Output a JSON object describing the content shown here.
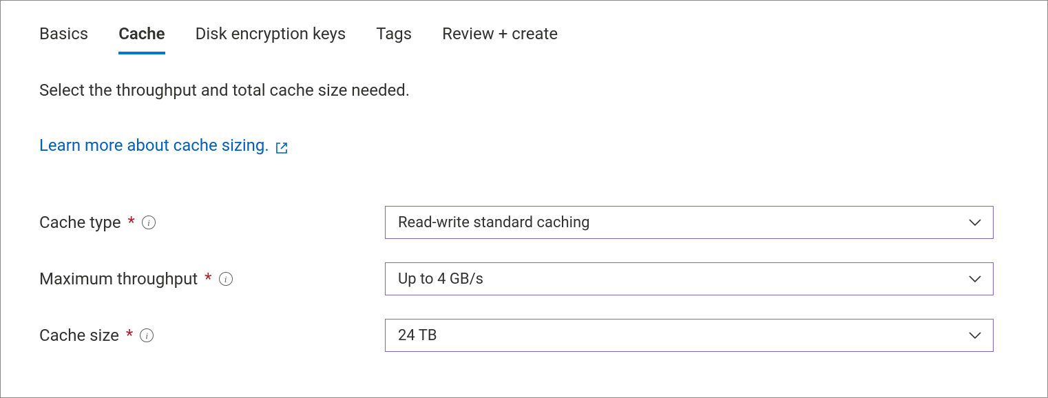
{
  "tabs": [
    {
      "label": "Basics",
      "active": false
    },
    {
      "label": "Cache",
      "active": true
    },
    {
      "label": "Disk encryption keys",
      "active": false
    },
    {
      "label": "Tags",
      "active": false
    },
    {
      "label": "Review + create",
      "active": false
    }
  ],
  "description": "Select the throughput and total cache size needed.",
  "learn_link": {
    "text": "Learn more about cache sizing."
  },
  "fields": {
    "cache_type": {
      "label": "Cache type",
      "required": true,
      "value": "Read-write standard caching"
    },
    "max_throughput": {
      "label": "Maximum throughput",
      "required": true,
      "value": "Up to 4 GB/s"
    },
    "cache_size": {
      "label": "Cache size",
      "required": true,
      "value": "24 TB"
    }
  },
  "colors": {
    "accent": "#0078d4",
    "link": "#0060b9",
    "select_border": "#8661c5",
    "required": "#a4262c"
  }
}
